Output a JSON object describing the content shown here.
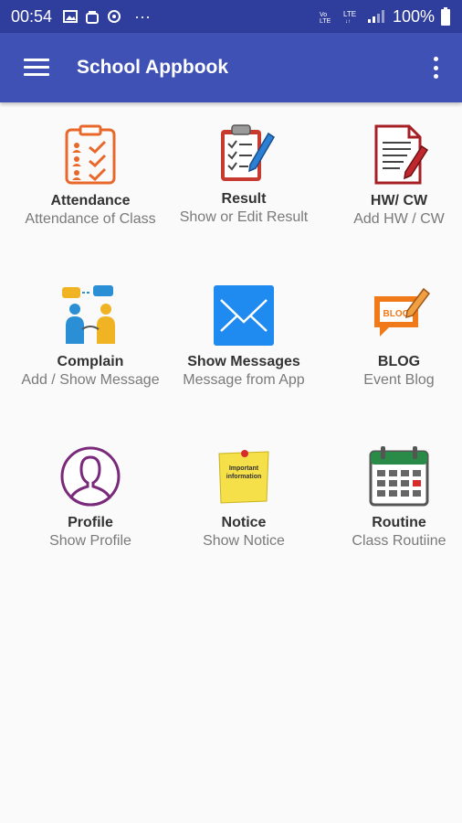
{
  "status": {
    "time": "00:54",
    "dots": "···",
    "battery": "100%"
  },
  "appbar": {
    "title": "School Appbook"
  },
  "tiles": [
    {
      "title": "Attendance",
      "subtitle": "Attendance of Class",
      "icon": "attendance-clipboard-icon"
    },
    {
      "title": "Result",
      "subtitle": "Show or Edit Result",
      "icon": "result-clipboard-pen-icon"
    },
    {
      "title": "HW/ CW",
      "subtitle": "Add HW / CW",
      "icon": "homework-document-pen-icon"
    },
    {
      "title": "Complain",
      "subtitle": "Add / Show Message",
      "icon": "complain-people-chat-icon"
    },
    {
      "title": "Show Messages",
      "subtitle": "Message from App",
      "icon": "mail-envelope-icon"
    },
    {
      "title": "BLOG",
      "subtitle": "Event Blog",
      "icon": "blog-speech-bubble-icon"
    },
    {
      "title": "Profile",
      "subtitle": "Show Profile",
      "icon": "profile-person-icon"
    },
    {
      "title": "Notice",
      "subtitle": "Show Notice",
      "icon": "notice-sticky-note-icon",
      "note_text": "Important information"
    },
    {
      "title": "Routine",
      "subtitle": "Class Routiine",
      "icon": "calendar-icon"
    }
  ],
  "colors": {
    "statusbar": "#2f3d9c",
    "appbar": "#3f51b5",
    "background": "#fafafa"
  }
}
